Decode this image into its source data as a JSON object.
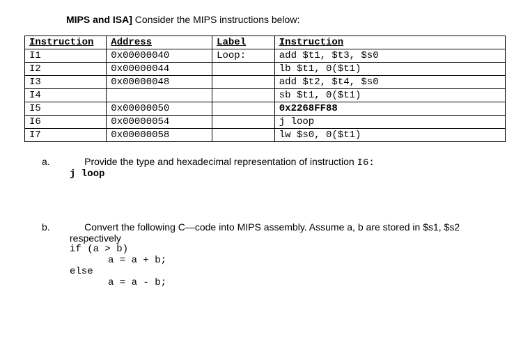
{
  "title_bold": "MIPS and ISA]",
  "title_rest": "Consider the MIPS instructions below:",
  "headers": {
    "col1": "Instruction",
    "col2": "Address",
    "col3": "Label",
    "col4": "Instruction"
  },
  "rows": [
    {
      "inst": "I1",
      "addr": "0x00000040",
      "label": "Loop:",
      "asm": "add $t1, $t3, $s0"
    },
    {
      "inst": "I2",
      "addr": "0x00000044",
      "label": "",
      "asm": "lb  $t1, 0($t1)"
    },
    {
      "inst": "I3",
      "addr": "0x00000048",
      "label": "",
      "asm": "add $t2, $t4, $s0"
    },
    {
      "inst": "I4",
      "addr": "",
      "label": "",
      "asm": "sb  $t1, 0($t1)"
    },
    {
      "inst": "I5",
      "addr": "0x00000050",
      "label": "",
      "asm": "0x2268FF88"
    },
    {
      "inst": "I6",
      "addr": "0x00000054",
      "label": "",
      "asm": "j   loop"
    },
    {
      "inst": "I7",
      "addr": "0x00000058",
      "label": "",
      "asm": "lw   $s0, 0($t1)"
    }
  ],
  "qa": {
    "label": "a.",
    "text": "Provide the type and hexadecimal representation of instruction ",
    "code_ref": "I6:",
    "code": "j loop"
  },
  "qb": {
    "label": "b.",
    "text": "Convert the following  C—code into MIPS assembly. Assume a, b are stored in $s1, $s2",
    "line1": "respectively",
    "code1": "if (a > b)",
    "code2": "a = a + b;",
    "code3": "else",
    "code4": "a = a - b;"
  }
}
